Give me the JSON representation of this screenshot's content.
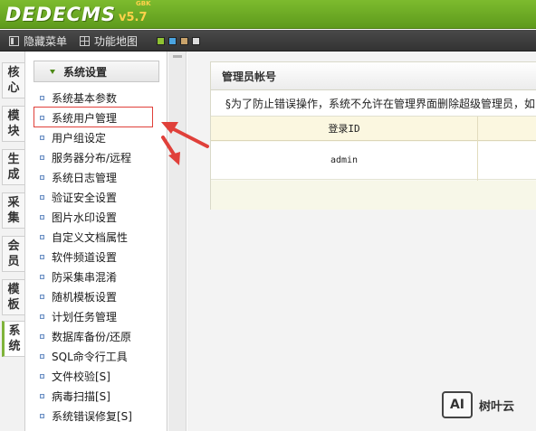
{
  "header": {
    "logo_text": "DEDECMS",
    "version": "v5.7",
    "version_tag": "GBK",
    "colors": {
      "header_green": "#6aa823",
      "toolbar_dark": "#3d3d3d"
    }
  },
  "toolbar": {
    "hide_menu_label": "隐藏菜单",
    "function_map_label": "功能地图",
    "skin_colors": [
      "#8fc232",
      "#4aa3df",
      "#c9a36b",
      "#dcdcdc"
    ]
  },
  "vtabs": [
    {
      "label": "核心",
      "active": false
    },
    {
      "label": "模块",
      "active": false
    },
    {
      "label": "生成",
      "active": false
    },
    {
      "label": "采集",
      "active": false
    },
    {
      "label": "会员",
      "active": false
    },
    {
      "label": "模板",
      "active": false
    },
    {
      "label": "系统",
      "active": true
    }
  ],
  "menu": {
    "title": "系统设置",
    "items": [
      "系统基本参数",
      "系统用户管理",
      "用户组设定",
      "服务器分布/远程",
      "系统日志管理",
      "验证安全设置",
      "图片水印设置",
      "自定义文档属性",
      "软件频道设置",
      "防采集串混淆",
      "随机模板设置",
      "计划任务管理",
      "数据库备份/还原",
      "SQL命令行工具",
      "文件校验[S]",
      "病毒扫描[S]",
      "系统错误修复[S]"
    ],
    "highlighted_item": "系统用户管理",
    "highlight_color": "#e0403a"
  },
  "main": {
    "title": "管理员帐号",
    "notice": "§为了防止错误操作，系统不允许在管理界面删除超级管理员，如",
    "table": {
      "headers": [
        "登录ID"
      ],
      "rows": [
        [
          "admin"
        ]
      ]
    }
  },
  "watermark": {
    "logo_text": "AI",
    "brand": "树叶云"
  }
}
